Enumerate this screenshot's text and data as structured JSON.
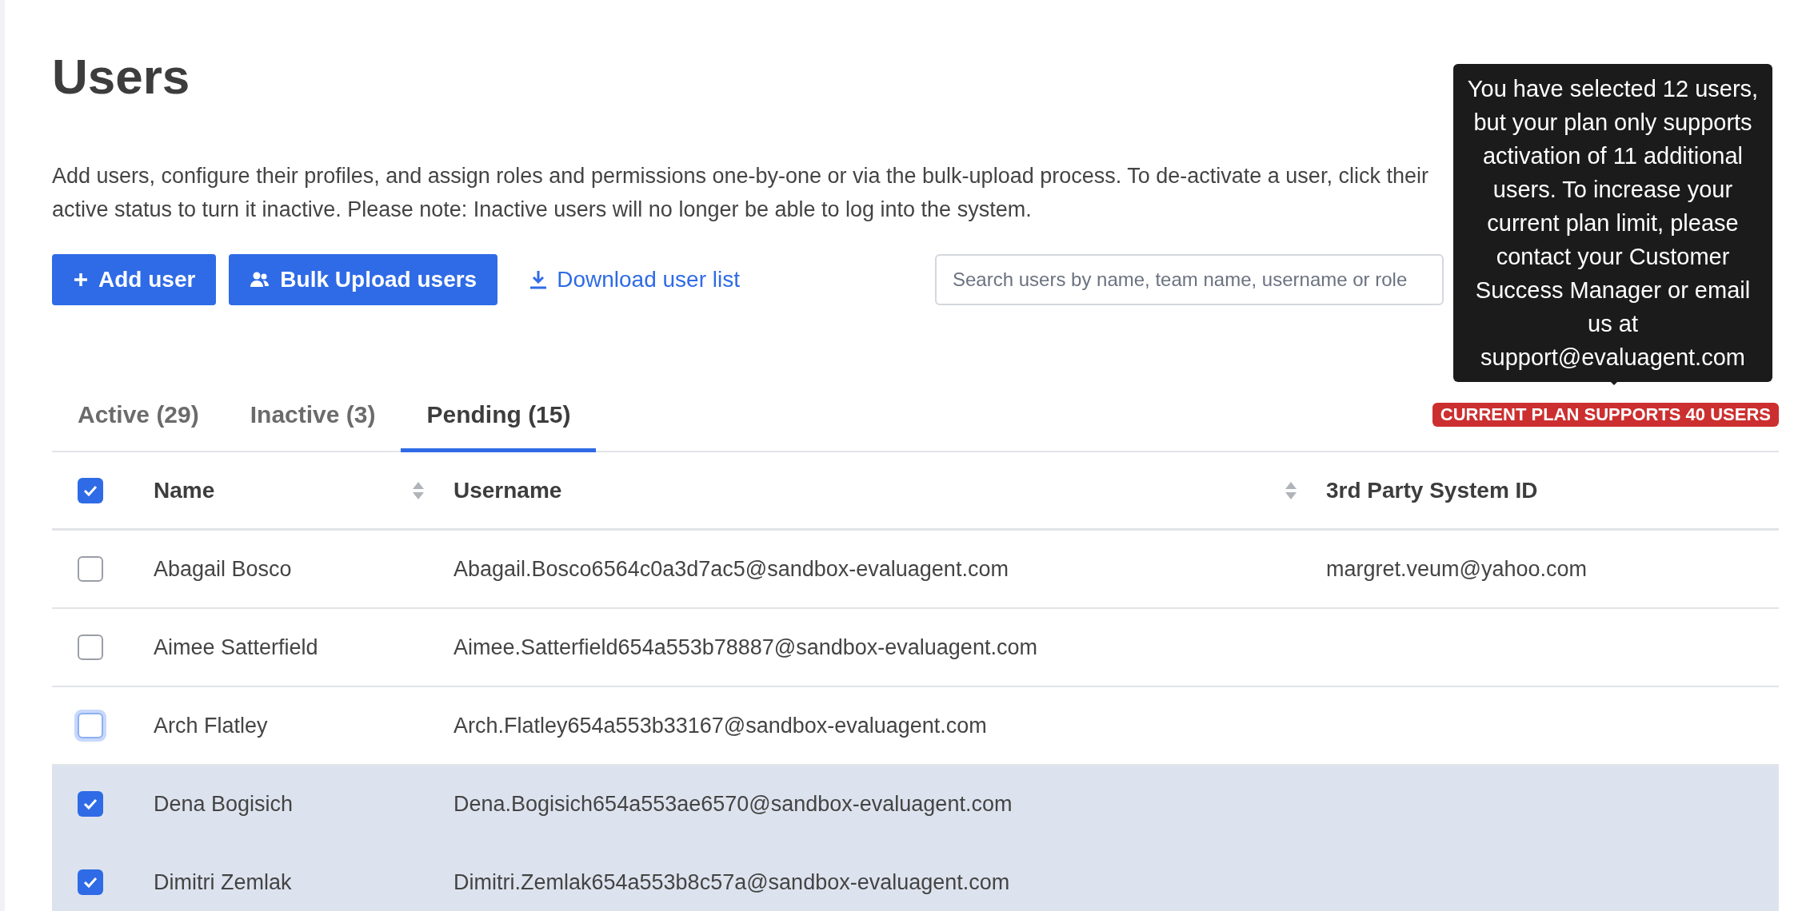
{
  "page_title": "Users",
  "description": "Add users, configure their profiles, and assign roles and permissions one-by-one or via the bulk-upload process. To de-activate a user, click their active status to turn it inactive. Please note: Inactive users will no longer be able to log into the system.",
  "actions": [
    {
      "kind": "add",
      "label": "Add user"
    },
    {
      "kind": "bulk",
      "label": "Bulk Upload users"
    },
    {
      "kind": "download",
      "label": "Download user list"
    }
  ],
  "search": {
    "placeholder": "Search users by name, team name, username or role"
  },
  "tabs": [
    {
      "label": "Active (29)",
      "selected": false
    },
    {
      "label": "Inactive (3)",
      "selected": false
    },
    {
      "label": "Pending (15)",
      "selected": true
    }
  ],
  "plan_badge": "CURRENT PLAN SUPPORTS 40 USERS",
  "tooltip": "You have selected 12 users, but your plan only supports activation of 11 additional users. To increase your current plan limit, please contact your Customer Success Manager or email us at support@evaluagent.com",
  "table": {
    "select_all": {
      "checked": true
    },
    "columns": [
      {
        "label": "Name",
        "sortable": true
      },
      {
        "label": "Username",
        "sortable": true
      },
      {
        "label": "3rd Party System ID",
        "sortable": false
      }
    ],
    "rows": [
      {
        "name": "Abagail Bosco",
        "username": "Abagail.Bosco6564c0a3d7ac5@sandbox-evaluagent.com",
        "system_id": "margret.veum@yahoo.com",
        "selected": false,
        "focused": false
      },
      {
        "name": "Aimee Satterfield",
        "username": "Aimee.Satterfield654a553b78887@sandbox-evaluagent.com",
        "selected": false,
        "focused": false
      },
      {
        "name": "Arch Flatley",
        "username": "Arch.Flatley654a553b33167@sandbox-evaluagent.com",
        "selected": false,
        "focused": true
      },
      {
        "name": "Dena Bogisich",
        "username": "Dena.Bogisich654a553ae6570@sandbox-evaluagent.com",
        "selected": true,
        "focused": false
      },
      {
        "name": "Dimitri Zemlak",
        "username": "Dimitri.Zemlak654a553b8c57a@sandbox-evaluagent.com",
        "selected": true,
        "focused": false
      }
    ]
  }
}
